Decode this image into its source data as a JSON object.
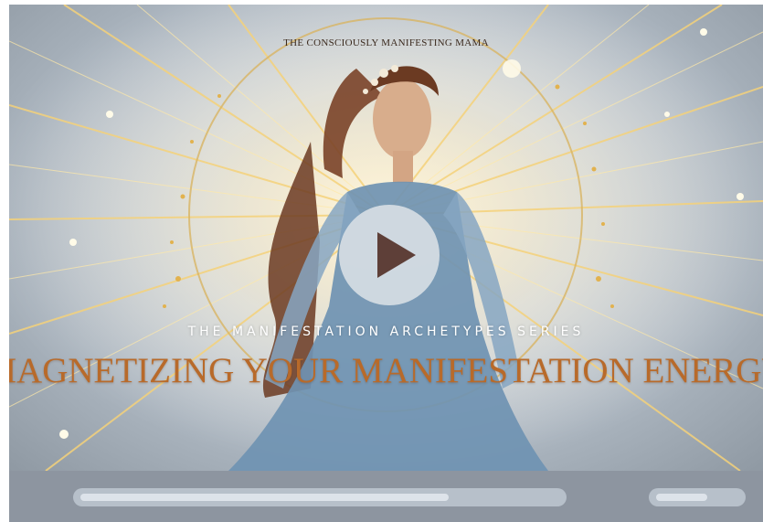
{
  "video": {
    "brand_text": "THE CONSCIOUSLY MANIFESTING MAMA",
    "series_text": "THE MANIFESTATION ARCHETYPES SERIES",
    "headline_text": "MAGNETIZING YOUR MANIFESTATION ENERGY",
    "play_icon": "play-icon"
  },
  "controls": {
    "progress_fraction": 0.77,
    "volume_fraction": 0.62
  },
  "colors": {
    "headline": "#b86a2a",
    "controls_bar": "#8d95a0",
    "track": "#b7c0ca",
    "fill": "#dde3ea"
  }
}
